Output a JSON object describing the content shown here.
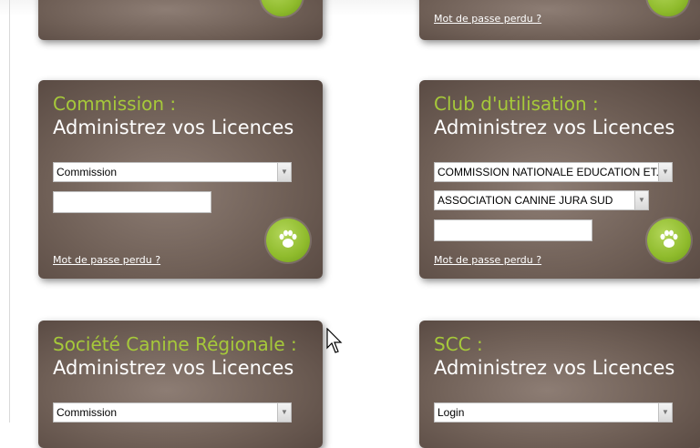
{
  "top_row": {
    "right_card_link": "Mot de passe perdu ?"
  },
  "cards": {
    "commission": {
      "title": "Commission :",
      "subtitle": "Administrez vos Licences",
      "select_value": "Commission",
      "password_value": "",
      "link": "Mot de passe perdu ?"
    },
    "club": {
      "title": "Club d'utilisation :",
      "subtitle": "Administrez vos Licences",
      "select1_value": "COMMISSION NATIONALE EDUCATION ET...",
      "select2_value": "ASSOCIATION CANINE JURA SUD",
      "password_value": "•••",
      "link": "Mot de passe perdu ?"
    },
    "scr": {
      "title": "Société Canine Régionale :",
      "subtitle": "Administrez vos Licences",
      "select_value": "Commission"
    },
    "scc": {
      "title": "SCC :",
      "subtitle": "Administrez vos Licences",
      "select_value": "Login"
    }
  },
  "icons": {
    "submit": "paw-icon",
    "dropdown": "chevron-down-icon",
    "cursor": "mouse-cursor-icon"
  },
  "colors": {
    "card_bg": "#6f5f56",
    "title_green": "#a6c93a",
    "button_green": "#8fbb2c"
  }
}
